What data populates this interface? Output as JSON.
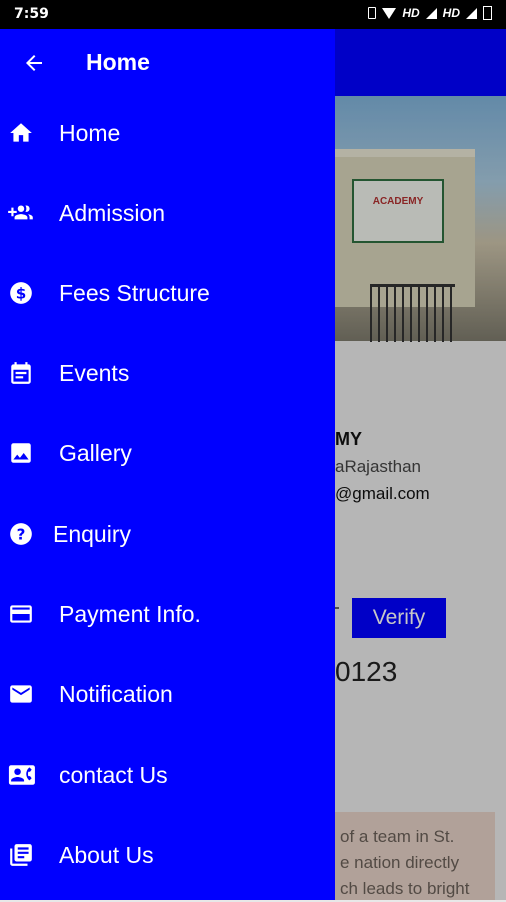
{
  "status_bar": {
    "time": "7:59",
    "network_1": "HD",
    "network_2": "HD"
  },
  "drawer": {
    "title": "Home",
    "background_color": "#0000ff",
    "items": [
      {
        "label": "Home",
        "icon": "home-icon"
      },
      {
        "label": "Admission",
        "icon": "people-add-icon"
      },
      {
        "label": "Fees Structure",
        "icon": "dollar-circle-icon"
      },
      {
        "label": "Events",
        "icon": "calendar-icon"
      },
      {
        "label": "Gallery",
        "icon": "image-icon"
      },
      {
        "label": "Enquiry",
        "icon": "help-circle-icon"
      },
      {
        "label": "Payment Info.",
        "icon": "credit-card-icon"
      },
      {
        "label": "Notification",
        "icon": "mail-icon"
      },
      {
        "label": "contact Us",
        "icon": "contact-card-icon"
      },
      {
        "label": "About Us",
        "icon": "library-books-icon"
      }
    ]
  },
  "background_page": {
    "school_sign": "ACADEMY",
    "school_name_fragment": "MY",
    "address_fragment": "aRajasthan",
    "email_fragment": "@gmail.com",
    "verify_button": "Verify",
    "phone_fragment": "0123",
    "about_lines": [
      "of a team in St.",
      "e nation directly",
      "ch leads to bright"
    ]
  }
}
